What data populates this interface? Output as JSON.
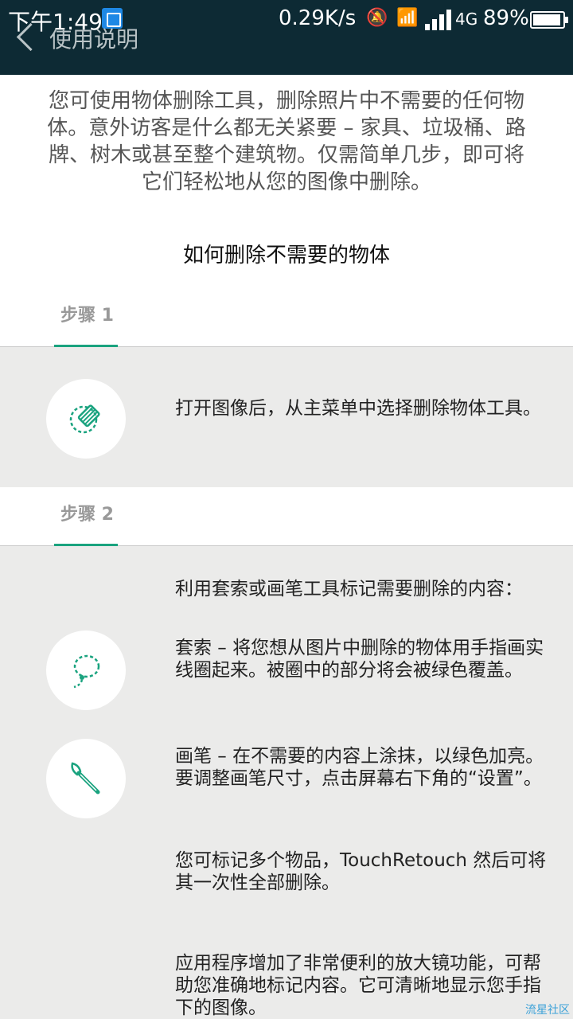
{
  "status_bar": {
    "time": "下午1:49",
    "speed": "0.29K/s",
    "network": "4G",
    "battery": "89%"
  },
  "app_bar": {
    "title": "使用说明"
  },
  "intro": {
    "text": "您可使用物体删除工具，删除照片中不需要的任何物体。意外访客是什么都无关紧要 – 家具、垃圾桶、路牌、树木或甚至整个建筑物。仅需简单几步，即可将它们轻松地从您的图像中删除。"
  },
  "howto_title": "如何删除不需要的物体",
  "step1": {
    "label": "步骤 1",
    "text": "打开图像后，从主菜单中选择删除物体工具。",
    "icon": "object-remove-icon"
  },
  "step2": {
    "label": "步骤 2",
    "intro": "利用套索或画笔工具标记需要删除的内容：",
    "lasso_text": "套索 – 将您想从图片中删除的物体用手指画实线圈起来。被圈中的部分将会被绿色覆盖。",
    "brush_text": "画笔 – 在不需要的内容上涂抹，以绿色加亮。要调整画笔尺寸，点击屏幕右下角的“设置”。",
    "multi_text": "您可标记多个物品，TouchRetouch 然后可将其一次性全部删除。",
    "magnifier_text": "应用程序增加了非常便利的放大镜功能，可帮助您准确地标记内容。它可清晰地显示您手指下的图像。"
  },
  "watermark": "流星社区",
  "colors": {
    "accent": "#1aa37f",
    "appbar": "#0d2a34",
    "background": "#ebebea"
  }
}
